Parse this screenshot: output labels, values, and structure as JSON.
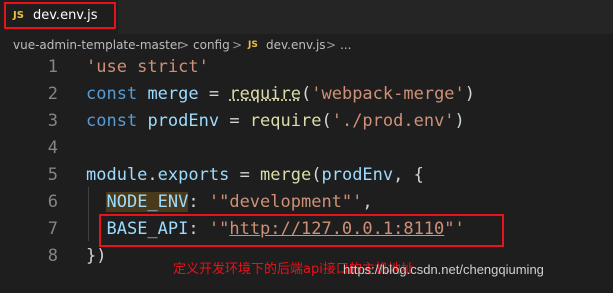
{
  "tab": {
    "badge": "JS",
    "filename": "dev.env.js"
  },
  "breadcrumb": {
    "folder1": "vue-admin-template-master",
    "folder2": "config",
    "badge": "JS",
    "file": "dev.env.js",
    "ellipsis": "...",
    "sep": ">"
  },
  "code": {
    "line_numbers": [
      "1",
      "2",
      "3",
      "4",
      "5",
      "6",
      "7",
      "8"
    ],
    "l1_str": "'use strict'",
    "l2_kw": "const",
    "l2_var": "merge",
    "l2_eq": " = ",
    "l2_fn": "require",
    "l2_open": "(",
    "l2_str": "'webpack-merge'",
    "l2_close": ")",
    "l3_kw": "const",
    "l3_var": "prodEnv",
    "l3_eq": " = ",
    "l3_fn": "require",
    "l3_open": "(",
    "l3_str": "'./prod.env'",
    "l3_close": ")",
    "l5_obj": "module",
    "l5_dot": ".",
    "l5_prop": "exports",
    "l5_eq": " = ",
    "l5_fn": "merge",
    "l5_open": "(",
    "l5_arg": "prodEnv",
    "l5_rest": ", {",
    "l6_key": "NODE_ENV",
    "l6_colon": ": ",
    "l6_str": "'\"development\"'",
    "l6_comma": ",",
    "l7_key": "BASE_API",
    "l7_colon": ": ",
    "l7_str_open": "'\"",
    "l7_url": "http://127.0.0.1:8110",
    "l7_str_close": "\"'",
    "l8": "})"
  },
  "annotation": "定义开发环境下的后端api接口的主机地址",
  "watermark": "https://blog.csdn.net/chengqiuming",
  "colors": {
    "highlight": "#e8131a",
    "string": "#ce9178",
    "keyword": "#569cd6",
    "variable": "#9cdcfe",
    "function": "#dcdcaa"
  }
}
